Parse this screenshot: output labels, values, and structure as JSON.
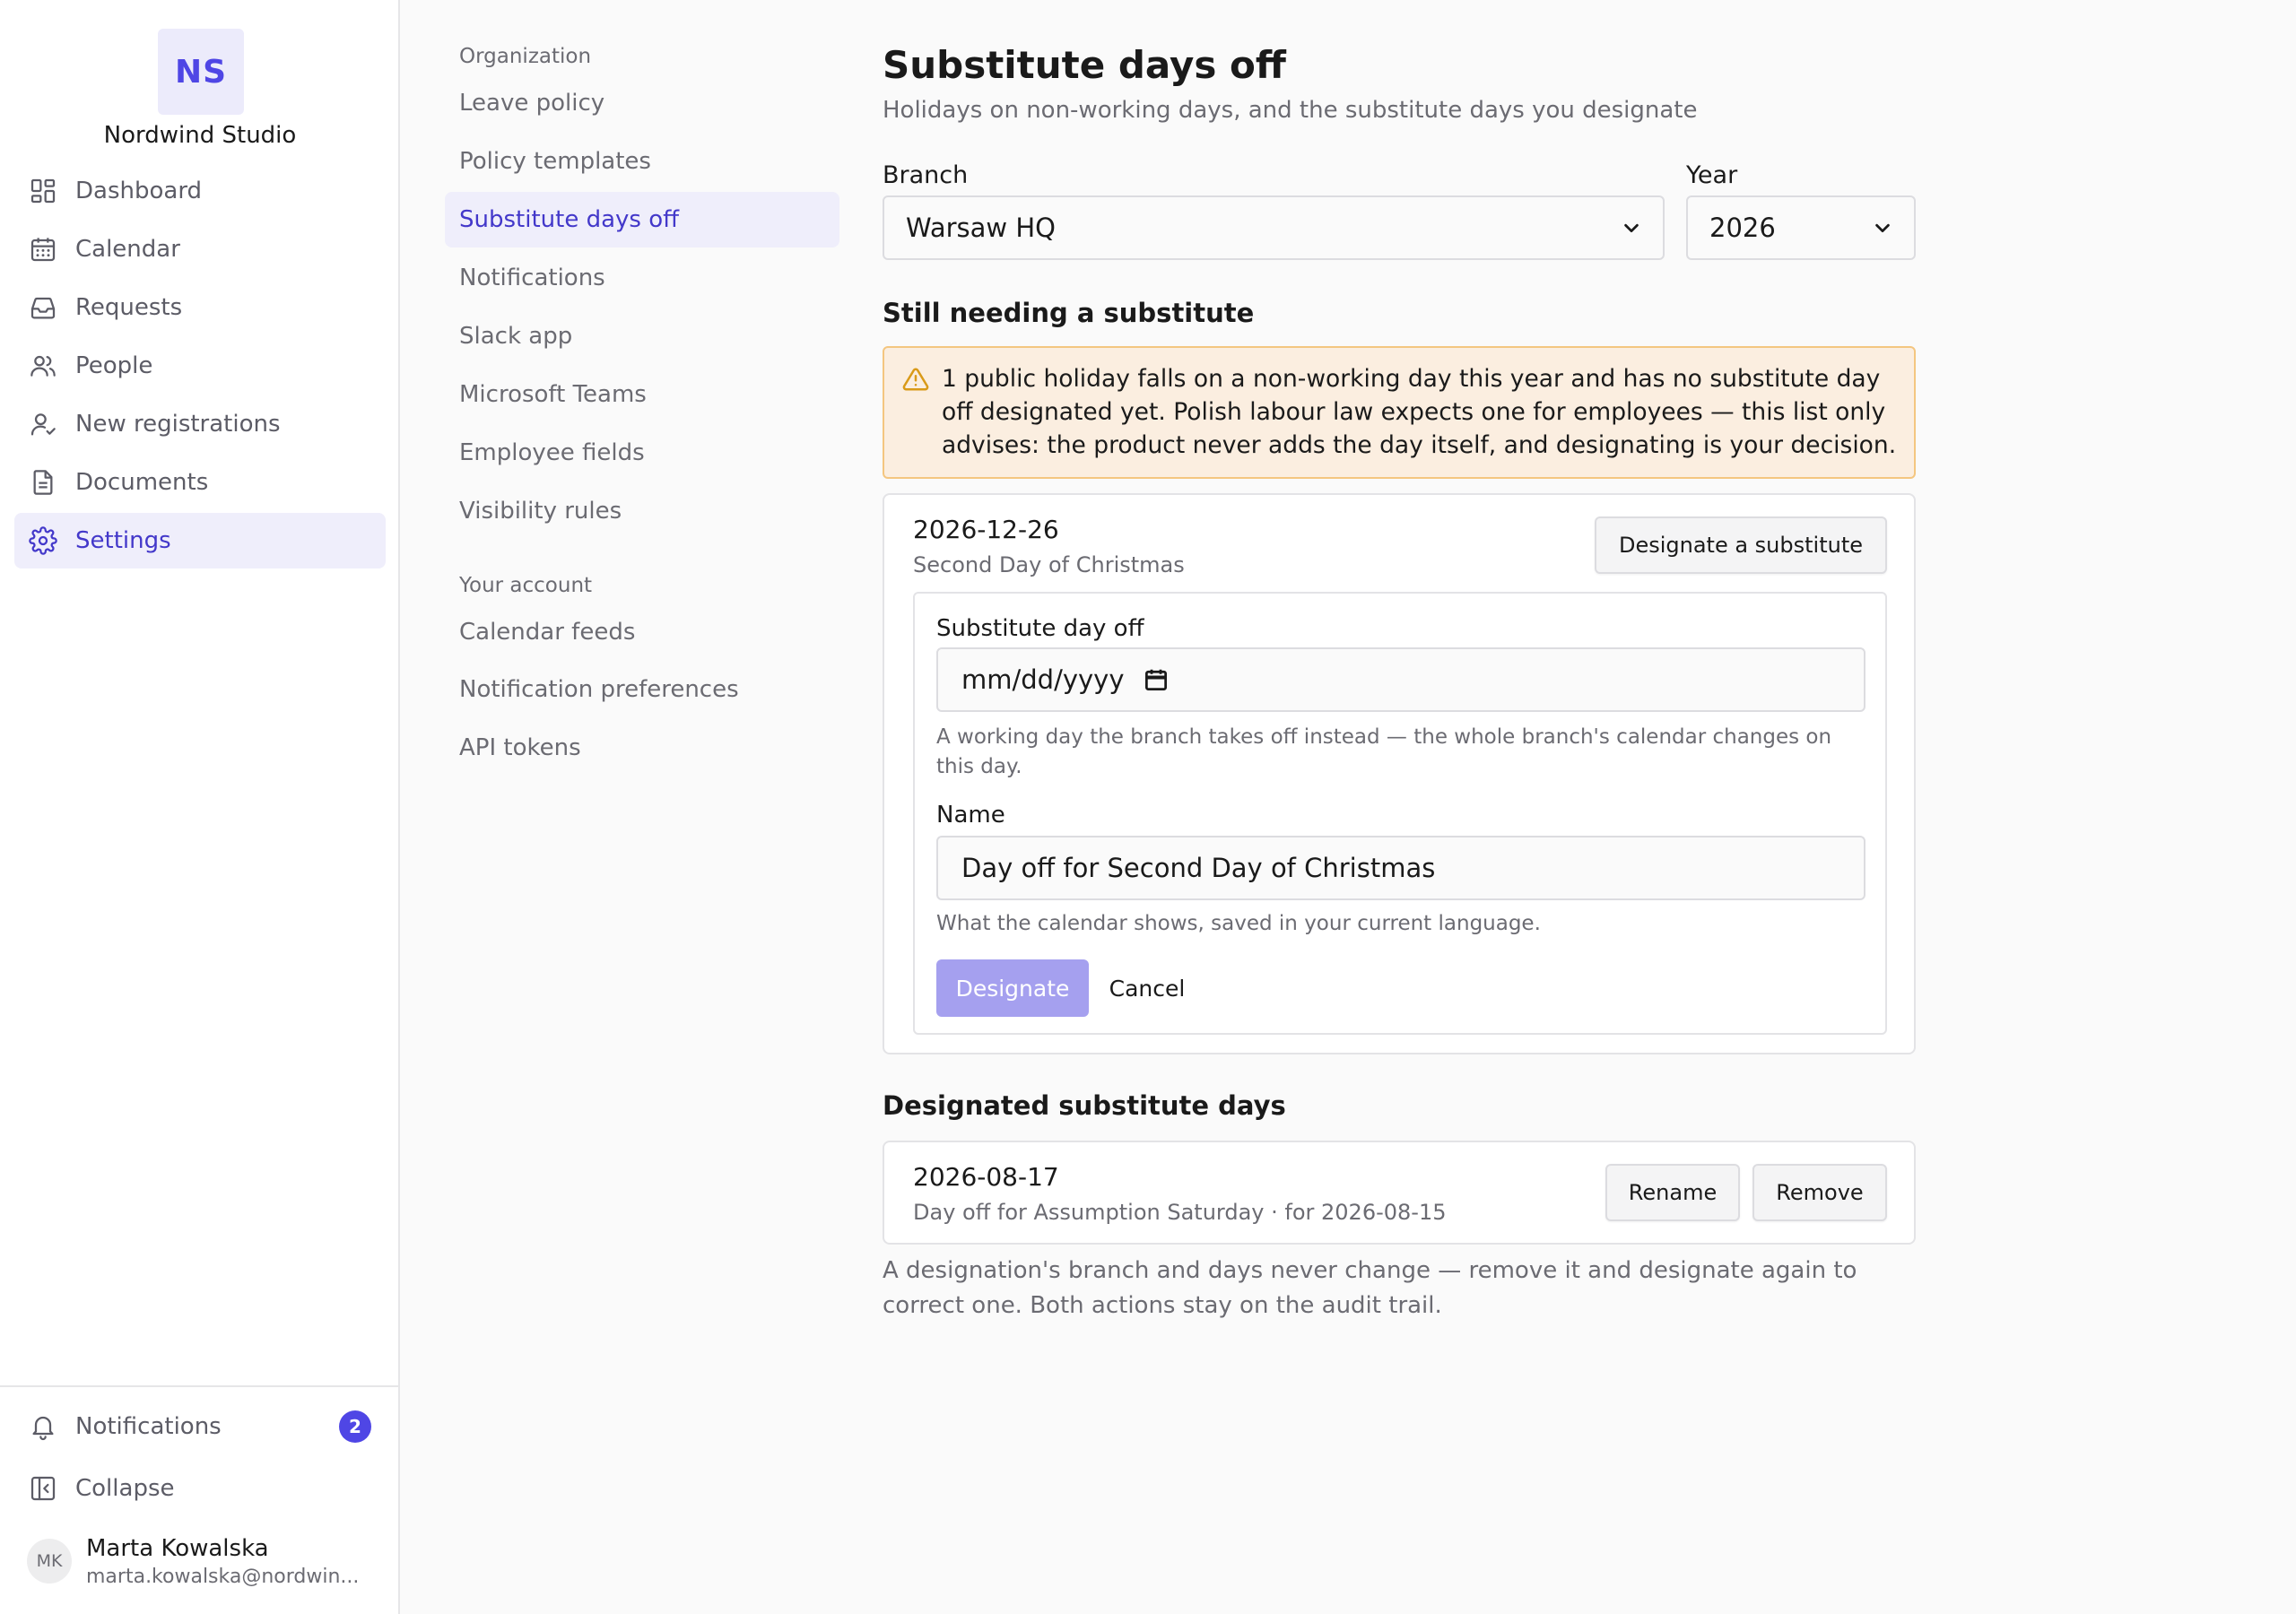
{
  "brand": {
    "initials": "NS",
    "name": "Nordwind Studio"
  },
  "sidebar": {
    "items": [
      {
        "label": "Dashboard",
        "icon": "dashboard-icon"
      },
      {
        "label": "Calendar",
        "icon": "calendar-icon"
      },
      {
        "label": "Requests",
        "icon": "inbox-icon"
      },
      {
        "label": "People",
        "icon": "people-icon"
      },
      {
        "label": "New registrations",
        "icon": "user-check-icon"
      },
      {
        "label": "Documents",
        "icon": "document-icon"
      },
      {
        "label": "Settings",
        "icon": "gear-icon",
        "active": true
      }
    ],
    "notifications": {
      "label": "Notifications",
      "count": "2"
    },
    "collapse": {
      "label": "Collapse"
    },
    "user": {
      "initials": "MK",
      "name": "Marta Kowalska",
      "email": "marta.kowalska@nordwin..."
    }
  },
  "settings_nav": {
    "groups": [
      {
        "title": "Organization",
        "items": [
          "Leave policy",
          "Policy templates",
          "Substitute days off",
          "Notifications",
          "Slack app",
          "Microsoft Teams",
          "Employee fields",
          "Visibility rules"
        ]
      },
      {
        "title": "Your account",
        "items": [
          "Calendar feeds",
          "Notification preferences",
          "API tokens"
        ]
      }
    ],
    "active_item": "Substitute days off"
  },
  "page": {
    "title": "Substitute days off",
    "subtitle": "Holidays on non-working days, and the substitute days you designate"
  },
  "filters": {
    "branch": {
      "label": "Branch",
      "value": "Warsaw HQ"
    },
    "year": {
      "label": "Year",
      "value": "2026"
    }
  },
  "needing": {
    "title": "Still needing a substitute",
    "warning": "1 public holiday falls on a non-working day this year and has no substitute day off designated yet. Polish labour law expects one for employees — this list only advises: the product never adds the day itself, and designating is your decision.",
    "holiday": {
      "date": "2026-12-26",
      "name": "Second Day of Christmas",
      "designate_button": "Designate a substitute"
    },
    "form": {
      "date_label": "Substitute day off",
      "date_placeholder": "mm/dd/yyyy",
      "date_help": "A working day the branch takes off instead — the whole branch's calendar changes on this day.",
      "name_label": "Name",
      "name_value": "Day off for Second Day of Christmas",
      "name_help": "What the calendar shows, saved in your current language.",
      "submit": "Designate",
      "cancel": "Cancel"
    }
  },
  "designated": {
    "title": "Designated substitute days",
    "items": [
      {
        "date": "2026-08-17",
        "detail": "Day off for Assumption Saturday · for 2026-08-15",
        "rename": "Rename",
        "remove": "Remove"
      }
    ],
    "footnote": "A designation's branch and days never change — remove it and designate again to correct one. Both actions stay on the audit trail."
  },
  "colors": {
    "accent": "#4f46e5",
    "accent_soft": "#efeefb",
    "warning_bg": "#fbeee0",
    "warning_border": "#f4c680",
    "primary_disabled": "#a5a0ef"
  }
}
